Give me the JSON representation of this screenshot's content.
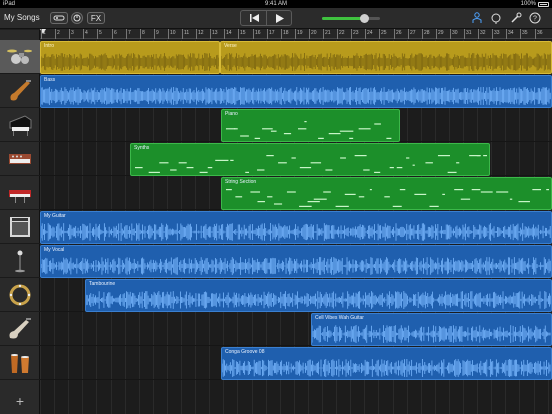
{
  "status": {
    "device": "iPad",
    "time": "9:41 AM",
    "battery": "100%"
  },
  "toolbar": {
    "my_songs": "My Songs",
    "fx": "FX",
    "volume_level": 0.72
  },
  "ruler": {
    "bars": [
      "1",
      "2",
      "3",
      "4",
      "5",
      "6",
      "7",
      "8",
      "9",
      "10",
      "11",
      "12",
      "13",
      "14",
      "15",
      "16",
      "17",
      "18",
      "19",
      "20",
      "21",
      "22",
      "23",
      "24",
      "25",
      "26",
      "27",
      "28",
      "29",
      "30",
      "31",
      "32",
      "33",
      "34",
      "35",
      "36"
    ]
  },
  "tracks": [
    {
      "name": "Drums",
      "icon": "drum-kit-icon",
      "selected": true,
      "regions": [
        {
          "label": "Intro",
          "kind": "audio-gold"
        },
        {
          "label": "Verse",
          "kind": "audio-gold"
        }
      ]
    },
    {
      "name": "Bass",
      "icon": "bass-guitar-icon",
      "regions": [
        {
          "label": "Bass",
          "kind": "audio-blue"
        }
      ]
    },
    {
      "name": "Piano",
      "icon": "piano-icon",
      "regions": [
        {
          "label": "Piano",
          "kind": "midi-green"
        }
      ]
    },
    {
      "name": "Synths",
      "icon": "synth-icon",
      "regions": [
        {
          "label": "Synths",
          "kind": "midi-green"
        }
      ]
    },
    {
      "name": "String Section",
      "icon": "keyboard-icon",
      "regions": [
        {
          "label": "String Section",
          "kind": "midi-green"
        }
      ]
    },
    {
      "name": "My Guitar",
      "icon": "amp-icon",
      "regions": [
        {
          "label": "My Guitar",
          "kind": "audio-blue"
        }
      ]
    },
    {
      "name": "My Vocal",
      "icon": "microphone-icon",
      "regions": [
        {
          "label": "My Vocal",
          "kind": "audio-blue"
        }
      ]
    },
    {
      "name": "Tambourine",
      "icon": "tambourine-icon",
      "regions": [
        {
          "label": "Tambourine",
          "kind": "audio-blue"
        }
      ]
    },
    {
      "name": "Cell Vibes Wah Guitar",
      "icon": "electric-guitar-icon",
      "regions": [
        {
          "label": "Cell Vibes Wah Guitar",
          "kind": "audio-blue"
        }
      ]
    },
    {
      "name": "Conga Groove 08",
      "icon": "conga-icon",
      "regions": [
        {
          "label": "Conga Groove 08",
          "kind": "audio-blue"
        }
      ]
    }
  ]
}
